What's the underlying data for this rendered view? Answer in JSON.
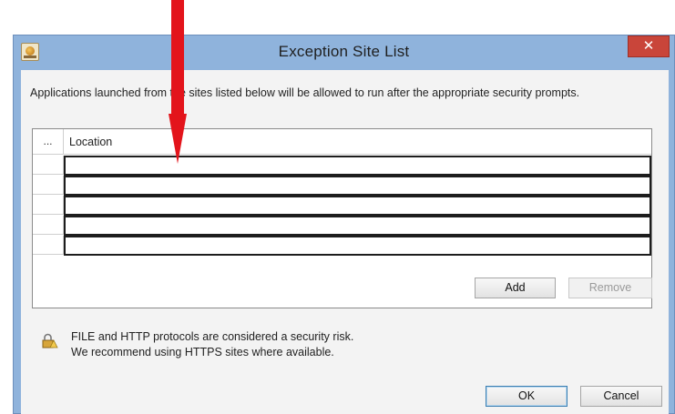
{
  "window": {
    "title": "Exception Site List",
    "close_label": "✕"
  },
  "intro_text": "Applications launched from the sites listed below will be allowed to run after the appropriate security prompts.",
  "table": {
    "columns": [
      "...",
      "Location"
    ],
    "rows": [
      "",
      "",
      "",
      "",
      ""
    ]
  },
  "buttons": {
    "add": "Add",
    "remove": "Remove",
    "ok": "OK",
    "cancel": "Cancel"
  },
  "warning": {
    "line1": "FILE and HTTP protocols are considered a security risk.",
    "line2": "We recommend using HTTPS sites where available."
  },
  "colors": {
    "title_bar": "#8fb3dc",
    "close_button": "#c9453a",
    "annotation_arrow": "#e3141b"
  },
  "icons": [
    "java-app-icon",
    "close-icon",
    "lock-warning-icon",
    "annotation-arrow"
  ]
}
